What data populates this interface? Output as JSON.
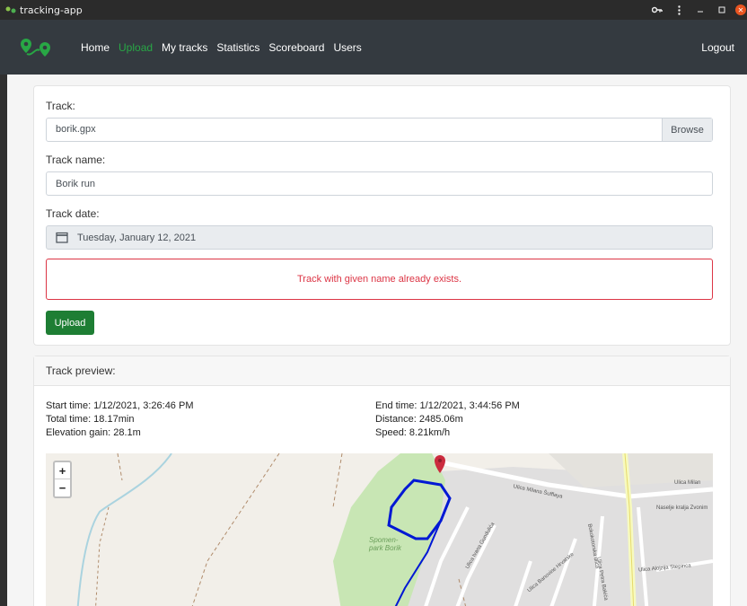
{
  "window": {
    "title": "tracking-app"
  },
  "nav": {
    "links": [
      "Home",
      "Upload",
      "My tracks",
      "Statistics",
      "Scoreboard",
      "Users"
    ],
    "active_index": 1,
    "logout": "Logout"
  },
  "form": {
    "track_label": "Track:",
    "file_name": "borik.gpx",
    "browse_label": "Browse",
    "name_label": "Track name:",
    "name_value": "Borik run",
    "date_label": "Track date:",
    "date_value": "Tuesday, January 12, 2021",
    "error": "Track with given name already exists.",
    "upload_label": "Upload"
  },
  "preview": {
    "header": "Track preview:",
    "start_time": "Start time: 1/12/2021, 3:26:46 PM",
    "total_time": "Total time: 18.17min",
    "elevation": "Elevation gain: 28.1m",
    "end_time": "End time: 1/12/2021, 3:44:56 PM",
    "distance": "Distance: 2485.06m",
    "speed": "Speed: 8.21km/h"
  },
  "map": {
    "zoom_in": "+",
    "zoom_out": "−",
    "labels": {
      "park": "Spomen-park Borik",
      "street1": "Ulica Milana Šufflaya",
      "street2": "Ulica Milan",
      "street3": "Naselje kralja Zvonim",
      "street4": "Ulica Petra Bakića",
      "street5": "Ulica Alojzija Stepinca",
      "street6": "Ulica Ivana Gundulića",
      "street7": "Bokokotorska ulica",
      "street8": "Ulica Banovine Hrvatske"
    }
  },
  "colors": {
    "navbar": "#343a40",
    "active_link": "#28a745",
    "error": "#dc3545",
    "upload_button": "#1e7e34",
    "track": "#0018d4"
  }
}
